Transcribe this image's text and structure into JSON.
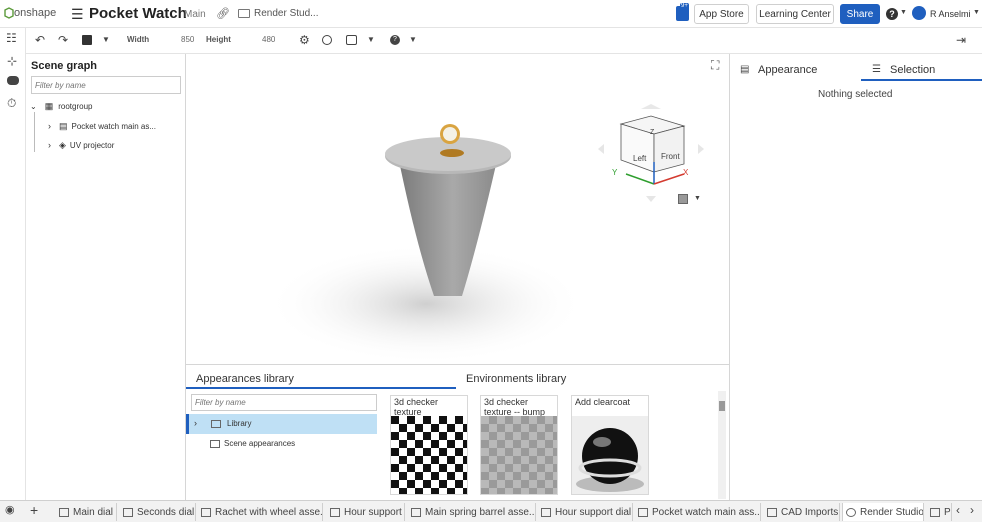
{
  "header": {
    "brand": "onshape",
    "doc_title": "Pocket Watch",
    "branch": "Main",
    "breadcrumb": "Render Stud...",
    "notif_count": "9+",
    "app_store": "App Store",
    "learning_center": "Learning Center",
    "share": "Share",
    "user": "R Anselmi"
  },
  "toolbar": {
    "width_label": "Width",
    "width_value": "850",
    "height_label": "Height",
    "height_value": "480"
  },
  "scene_graph": {
    "title": "Scene graph",
    "filter_placeholder": "Filter by name",
    "root": "rootgroup",
    "items": [
      "Pocket watch main as...",
      "UV projector"
    ]
  },
  "viewcube": {
    "left": "Left",
    "front": "Front",
    "top": "Z",
    "x_axis": "X",
    "y_axis": "Y"
  },
  "library": {
    "tabs": [
      "Appearances library",
      "Environments library"
    ],
    "filter_placeholder": "Filter by name",
    "tree": [
      "Library",
      "Scene appearances"
    ],
    "cards": [
      "3d checker texture",
      "3d checker texture -- bump",
      "Add clearcoat"
    ]
  },
  "right_panel": {
    "tabs": [
      "Appearance",
      "Selection"
    ],
    "empty_text": "Nothing selected"
  },
  "bottom_tabs": [
    "Main dial",
    "Seconds dial",
    "Rachet with wheel asse...",
    "Hour support",
    "Main spring barrel asse...",
    "Hour support dial",
    "Pocket watch main ass...",
    "CAD Imports",
    "Render Studio",
    "P"
  ],
  "colors": {
    "accent": "#1f5fbf",
    "share_bg": "#1f5fbf",
    "tab_underline": "#1f5fbf",
    "selected_row": "#bfe0f5"
  }
}
